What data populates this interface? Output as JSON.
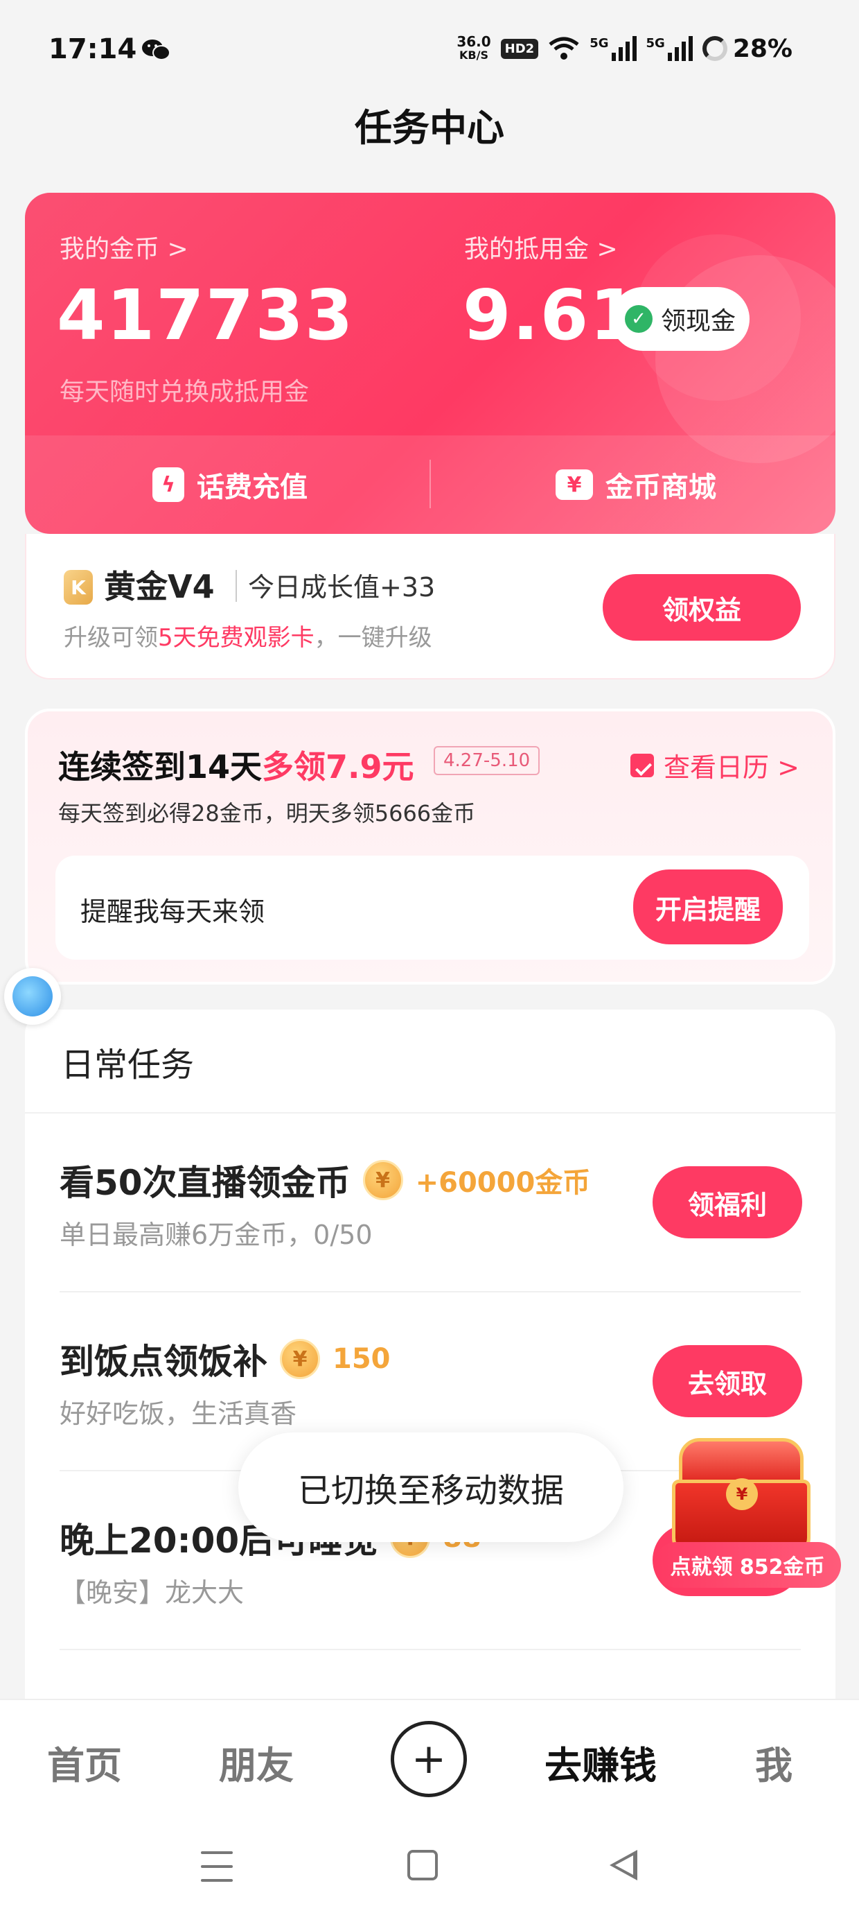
{
  "status_bar": {
    "time": "17:14",
    "net_speed_value": "36.0",
    "net_speed_unit": "KB/S",
    "hd": "HD2",
    "sig1": "5G",
    "sig2": "5G",
    "battery": "28%"
  },
  "page_title": "任务中心",
  "coin_card": {
    "coins_label": "我的金币 >",
    "coins_value": "417733",
    "coins_sub": "每天随时兑换成抵用金",
    "voucher_label": "我的抵用金 >",
    "voucher_value": "9.61",
    "withdraw_button": "领现金",
    "action_recharge": "话费充值",
    "action_mall": "金币商城"
  },
  "vip": {
    "badge": "K",
    "level": "黄金V4",
    "growth": "今日成长值+33",
    "hint_prefix": "升级可领",
    "hint_highlight": "5天免费观影卡",
    "hint_suffix": "，一键升级",
    "button": "领权益"
  },
  "signin": {
    "title_prefix": "连续签到14天",
    "title_highlight": "多领7.9元",
    "date_range": "4.27-5.10",
    "calendar_link": "查看日历 >",
    "subtitle": "每天签到必得28金币，明天多领5666金币",
    "remind_text": "提醒我每天来领",
    "remind_button": "开启提醒"
  },
  "daily": {
    "section_title": "日常任务",
    "tasks": [
      {
        "title": "看50次直播领金币",
        "reward": "+60000金币",
        "sub": "单日最高赚6万金币，0/50",
        "button": "领福利"
      },
      {
        "title": "到饭点领饭补",
        "reward": "150",
        "sub": "好好吃饭，生活真香",
        "button": "去领取"
      },
      {
        "title": "晚上20:00后可睡觉",
        "reward": "88",
        "sub": "【晚安】龙大大",
        "button": ""
      }
    ]
  },
  "toast": "已切换至移动数据",
  "chest_label": "点就领 852金币",
  "bottom_nav": {
    "home": "首页",
    "friends": "朋友",
    "plus": "+",
    "earn": "去赚钱",
    "me": "我"
  },
  "icons": {
    "coin_symbol": "¥",
    "lightning": "ϟ",
    "ticket": "¥"
  },
  "colors": {
    "brand": "#fe3a63",
    "coin_gold": "#f4a53a"
  }
}
